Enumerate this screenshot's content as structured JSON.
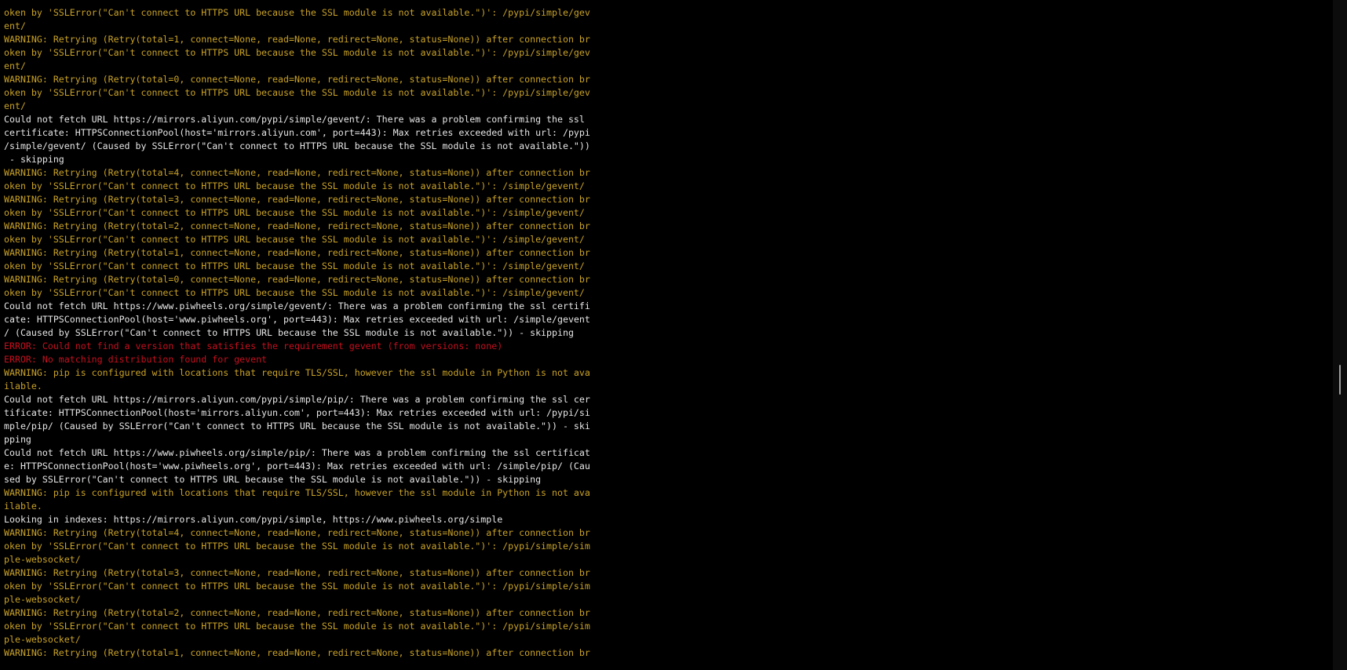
{
  "colors": {
    "background": "#000000",
    "warning": "#c9a227",
    "info": "#e6e6e6",
    "error": "#c50f1f"
  },
  "scrollbar": {
    "position_fraction": 0.57
  },
  "lines": [
    {
      "t": "oken by 'SSLError(\"Can't connect to HTTPS URL because the SSL module is not available.\")': /pypi/simple/gev",
      "s": "warn"
    },
    {
      "t": "ent/",
      "s": "warn"
    },
    {
      "t": "WARNING: Retrying (Retry(total=1, connect=None, read=None, redirect=None, status=None)) after connection br",
      "s": "warn"
    },
    {
      "t": "oken by 'SSLError(\"Can't connect to HTTPS URL because the SSL module is not available.\")': /pypi/simple/gev",
      "s": "warn"
    },
    {
      "t": "ent/",
      "s": "warn"
    },
    {
      "t": "WARNING: Retrying (Retry(total=0, connect=None, read=None, redirect=None, status=None)) after connection br",
      "s": "warn"
    },
    {
      "t": "oken by 'SSLError(\"Can't connect to HTTPS URL because the SSL module is not available.\")': /pypi/simple/gev",
      "s": "warn"
    },
    {
      "t": "ent/",
      "s": "warn"
    },
    {
      "t": "Could not fetch URL https://mirrors.aliyun.com/pypi/simple/gevent/: There was a problem confirming the ssl",
      "s": "info"
    },
    {
      "t": "certificate: HTTPSConnectionPool(host='mirrors.aliyun.com', port=443): Max retries exceeded with url: /pypi",
      "s": "info"
    },
    {
      "t": "/simple/gevent/ (Caused by SSLError(\"Can't connect to HTTPS URL because the SSL module is not available.\"))",
      "s": "info"
    },
    {
      "t": " - skipping",
      "s": "info"
    },
    {
      "t": "WARNING: Retrying (Retry(total=4, connect=None, read=None, redirect=None, status=None)) after connection br",
      "s": "warn"
    },
    {
      "t": "oken by 'SSLError(\"Can't connect to HTTPS URL because the SSL module is not available.\")': /simple/gevent/",
      "s": "warn"
    },
    {
      "t": "WARNING: Retrying (Retry(total=3, connect=None, read=None, redirect=None, status=None)) after connection br",
      "s": "warn"
    },
    {
      "t": "oken by 'SSLError(\"Can't connect to HTTPS URL because the SSL module is not available.\")': /simple/gevent/",
      "s": "warn"
    },
    {
      "t": "WARNING: Retrying (Retry(total=2, connect=None, read=None, redirect=None, status=None)) after connection br",
      "s": "warn"
    },
    {
      "t": "oken by 'SSLError(\"Can't connect to HTTPS URL because the SSL module is not available.\")': /simple/gevent/",
      "s": "warn"
    },
    {
      "t": "WARNING: Retrying (Retry(total=1, connect=None, read=None, redirect=None, status=None)) after connection br",
      "s": "warn"
    },
    {
      "t": "oken by 'SSLError(\"Can't connect to HTTPS URL because the SSL module is not available.\")': /simple/gevent/",
      "s": "warn"
    },
    {
      "t": "WARNING: Retrying (Retry(total=0, connect=None, read=None, redirect=None, status=None)) after connection br",
      "s": "warn"
    },
    {
      "t": "oken by 'SSLError(\"Can't connect to HTTPS URL because the SSL module is not available.\")': /simple/gevent/",
      "s": "warn"
    },
    {
      "t": "Could not fetch URL https://www.piwheels.org/simple/gevent/: There was a problem confirming the ssl certifi",
      "s": "info"
    },
    {
      "t": "cate: HTTPSConnectionPool(host='www.piwheels.org', port=443): Max retries exceeded with url: /simple/gevent",
      "s": "info"
    },
    {
      "t": "/ (Caused by SSLError(\"Can't connect to HTTPS URL because the SSL module is not available.\")) - skipping",
      "s": "info"
    },
    {
      "t": "ERROR: Could not find a version that satisfies the requirement gevent (from versions: none)",
      "s": "err"
    },
    {
      "t": "ERROR: No matching distribution found for gevent",
      "s": "err"
    },
    {
      "t": "WARNING: pip is configured with locations that require TLS/SSL, however the ssl module in Python is not ava",
      "s": "warn"
    },
    {
      "t": "ilable.",
      "s": "warn"
    },
    {
      "t": "Could not fetch URL https://mirrors.aliyun.com/pypi/simple/pip/: There was a problem confirming the ssl cer",
      "s": "info"
    },
    {
      "t": "tificate: HTTPSConnectionPool(host='mirrors.aliyun.com', port=443): Max retries exceeded with url: /pypi/si",
      "s": "info"
    },
    {
      "t": "mple/pip/ (Caused by SSLError(\"Can't connect to HTTPS URL because the SSL module is not available.\")) - ski",
      "s": "info"
    },
    {
      "t": "pping",
      "s": "info"
    },
    {
      "t": "Could not fetch URL https://www.piwheels.org/simple/pip/: There was a problem confirming the ssl certificat",
      "s": "info"
    },
    {
      "t": "e: HTTPSConnectionPool(host='www.piwheels.org', port=443): Max retries exceeded with url: /simple/pip/ (Cau",
      "s": "info"
    },
    {
      "t": "sed by SSLError(\"Can't connect to HTTPS URL because the SSL module is not available.\")) - skipping",
      "s": "info"
    },
    {
      "t": "WARNING: pip is configured with locations that require TLS/SSL, however the ssl module in Python is not ava",
      "s": "warn"
    },
    {
      "t": "ilable.",
      "s": "warn"
    },
    {
      "t": "Looking in indexes: https://mirrors.aliyun.com/pypi/simple, https://www.piwheels.org/simple",
      "s": "info"
    },
    {
      "t": "WARNING: Retrying (Retry(total=4, connect=None, read=None, redirect=None, status=None)) after connection br",
      "s": "warn"
    },
    {
      "t": "oken by 'SSLError(\"Can't connect to HTTPS URL because the SSL module is not available.\")': /pypi/simple/sim",
      "s": "warn"
    },
    {
      "t": "ple-websocket/",
      "s": "warn"
    },
    {
      "t": "WARNING: Retrying (Retry(total=3, connect=None, read=None, redirect=None, status=None)) after connection br",
      "s": "warn"
    },
    {
      "t": "oken by 'SSLError(\"Can't connect to HTTPS URL because the SSL module is not available.\")': /pypi/simple/sim",
      "s": "warn"
    },
    {
      "t": "ple-websocket/",
      "s": "warn"
    },
    {
      "t": "WARNING: Retrying (Retry(total=2, connect=None, read=None, redirect=None, status=None)) after connection br",
      "s": "warn"
    },
    {
      "t": "oken by 'SSLError(\"Can't connect to HTTPS URL because the SSL module is not available.\")': /pypi/simple/sim",
      "s": "warn"
    },
    {
      "t": "ple-websocket/",
      "s": "warn"
    },
    {
      "t": "WARNING: Retrying (Retry(total=1, connect=None, read=None, redirect=None, status=None)) after connection br",
      "s": "warn"
    }
  ]
}
